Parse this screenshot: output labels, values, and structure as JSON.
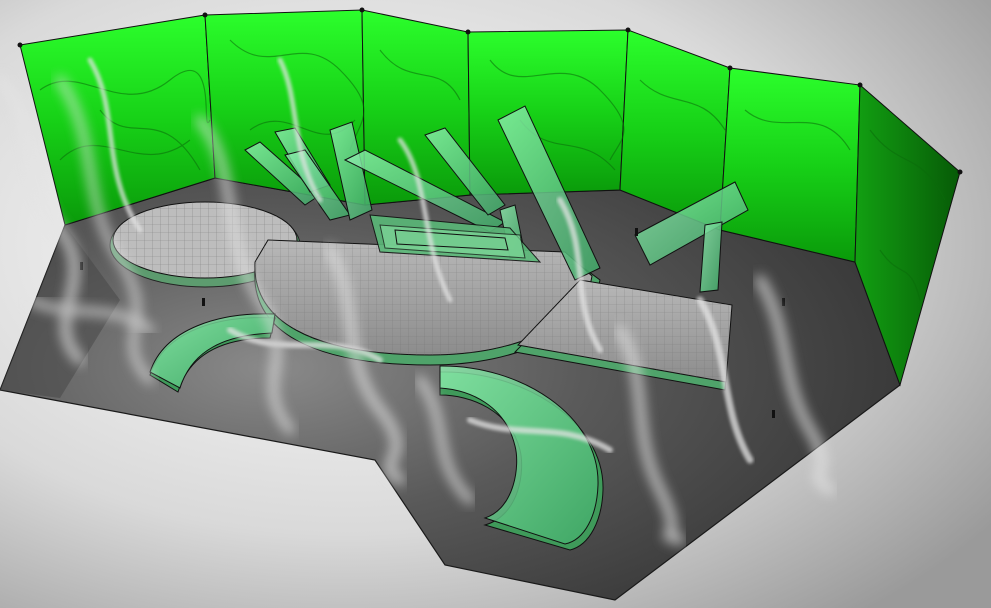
{
  "scene": {
    "subject": "",
    "colors": {
      "background_center": "#ffffff",
      "background_edge": "#9a9a9a",
      "floor": "#525252",
      "floor_light": "#7a7a7a",
      "screen_green": "#1fe01f",
      "screen_dark": "#0c7d0c",
      "glass_green": "#5fd08a",
      "outline": "#1a1a1a",
      "smoke": "#d8d8d8"
    }
  }
}
